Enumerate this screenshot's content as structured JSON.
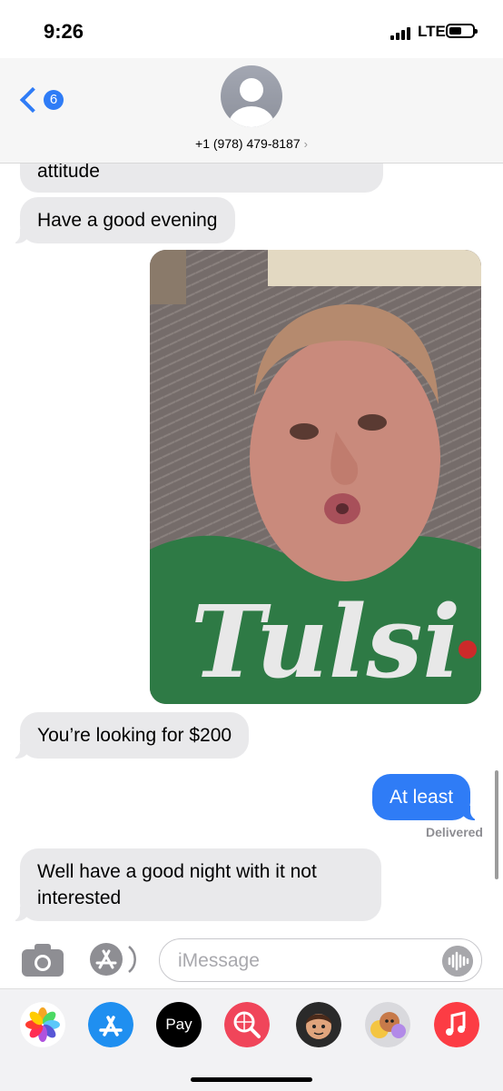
{
  "status_bar": {
    "time": "9:26",
    "network": "LTE"
  },
  "header": {
    "back_badge": "6",
    "contact": "+1 (978) 479-8187",
    "chevron": "›"
  },
  "messages": [
    {
      "direction": "incoming",
      "text": "attitude"
    },
    {
      "direction": "incoming",
      "text": "Have a good evening"
    },
    {
      "direction": "incoming",
      "type": "image",
      "shirt_text": "Tulsi"
    },
    {
      "direction": "incoming",
      "text": "You’re looking for $200"
    },
    {
      "direction": "outgoing",
      "text": "At least",
      "status": "Delivered"
    },
    {
      "direction": "incoming",
      "text": "Well have a good night with it not interested"
    }
  ],
  "composer": {
    "placeholder": "iMessage"
  },
  "app_drawer": {
    "apple_pay_label": "Pay",
    "apps": [
      "photos-icon",
      "app-store-icon",
      "apple-pay-icon",
      "search-images-icon",
      "memoji-icon",
      "animoji-icon",
      "music-icon"
    ]
  },
  "colors": {
    "accent": "#2f7cf6",
    "incoming_bubble": "#e9e9eb",
    "music": "#fc3c44"
  }
}
